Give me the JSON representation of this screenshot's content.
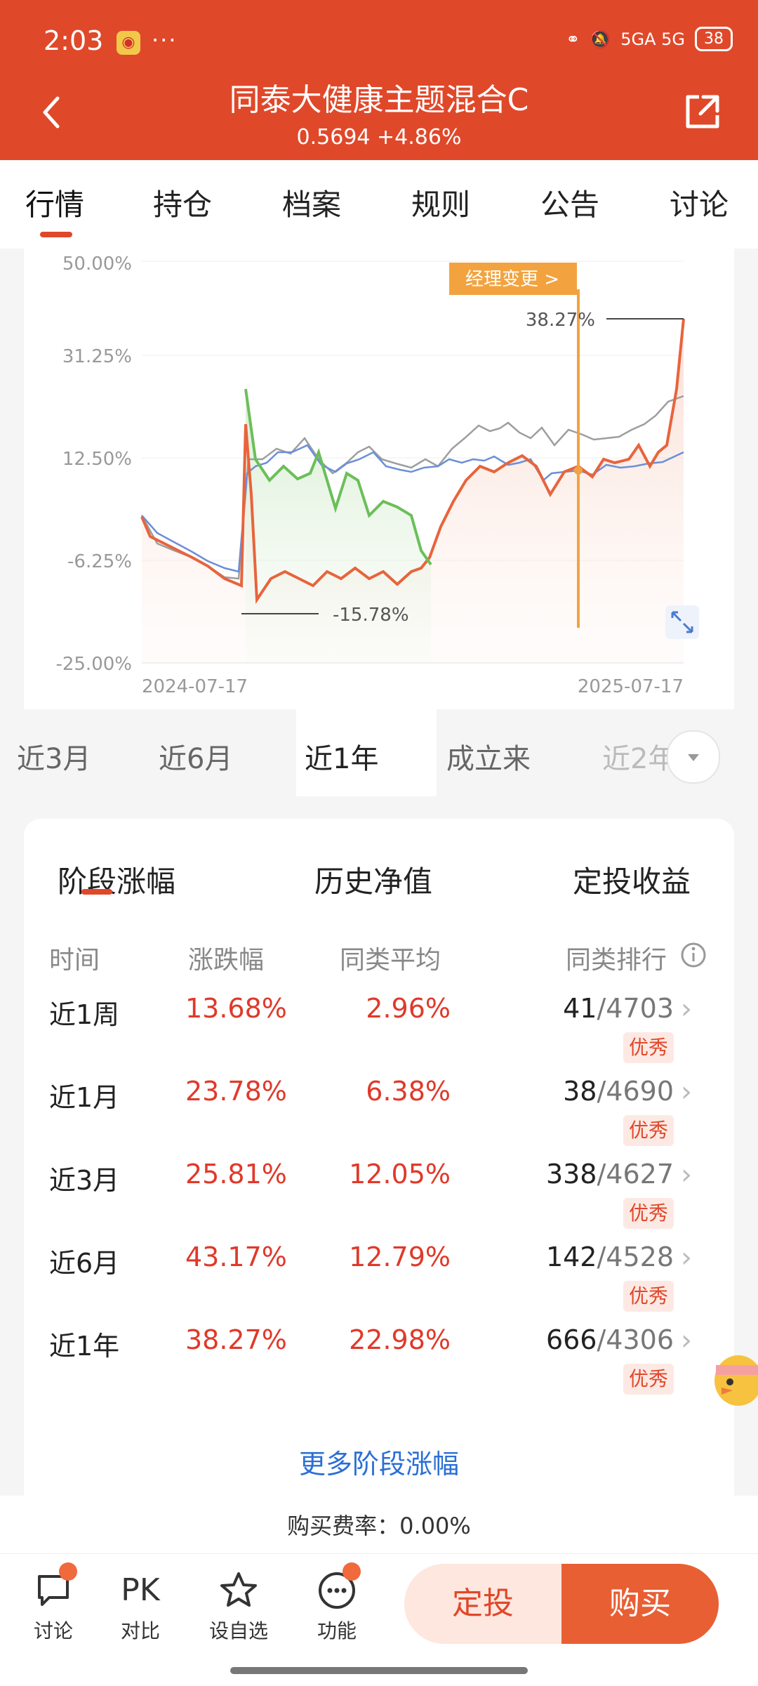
{
  "status_bar": {
    "time": "2:03",
    "dots": "···",
    "network": "5GA 5G",
    "battery": "38"
  },
  "header": {
    "title": "同泰大健康主题混合C",
    "subtitle": "0.5694 +4.86%"
  },
  "tabs": [
    "行情",
    "持仓",
    "档案",
    "规则",
    "公告",
    "讨论"
  ],
  "chart": {
    "y_ticks": [
      "50.00%",
      "31.25%",
      "12.50%",
      "-6.25%",
      "-25.00%"
    ],
    "x_start": "2024-07-17",
    "x_end": "2025-07-17",
    "max_label": "38.27%",
    "min_label": "-15.78%",
    "event_tag": "经理变更 >"
  },
  "chart_data": {
    "type": "line",
    "x": [
      "2024-07-17",
      "2025-07-17"
    ],
    "ylim": [
      -25,
      50
    ],
    "series": [],
    "annotations": {
      "max": "38.27%",
      "min": "-15.78%",
      "event": "经理变更"
    },
    "colors": {
      "fund": "#e8643c",
      "compare1": "#6b8fd8",
      "compare2": "#9a9a9a",
      "drawdown": "#6bbf59"
    }
  },
  "ranges": [
    "近3月",
    "近6月",
    "近1年",
    "成立来",
    "近2年"
  ],
  "selected_range": "近1年",
  "table": {
    "tabs": [
      "阶段涨幅",
      "历史净值",
      "定投收益"
    ],
    "headers": [
      "时间",
      "涨跌幅",
      "同类平均",
      "同类排行"
    ],
    "rows": [
      {
        "period": "近1周",
        "change": "13.68%",
        "avg": "2.96%",
        "rank": "41",
        "total": "/4703",
        "badge": "优秀"
      },
      {
        "period": "近1月",
        "change": "23.78%",
        "avg": "6.38%",
        "rank": "38",
        "total": "/4690",
        "badge": "优秀"
      },
      {
        "period": "近3月",
        "change": "25.81%",
        "avg": "12.05%",
        "rank": "338",
        "total": "/4627",
        "badge": "优秀"
      },
      {
        "period": "近6月",
        "change": "43.17%",
        "avg": "12.79%",
        "rank": "142",
        "total": "/4528",
        "badge": "优秀"
      },
      {
        "period": "近1年",
        "change": "38.27%",
        "avg": "22.98%",
        "rank": "666",
        "total": "/4306",
        "badge": "优秀"
      }
    ],
    "more_link": "更多阶段涨幅"
  },
  "fee": "购买费率：0.00%",
  "bottom_nav": [
    {
      "label": "讨论"
    },
    {
      "label": "对比",
      "icon_text": "PK"
    },
    {
      "label": "设自选"
    },
    {
      "label": "功能"
    }
  ],
  "actions": {
    "ding": "定投",
    "buy": "购买"
  }
}
